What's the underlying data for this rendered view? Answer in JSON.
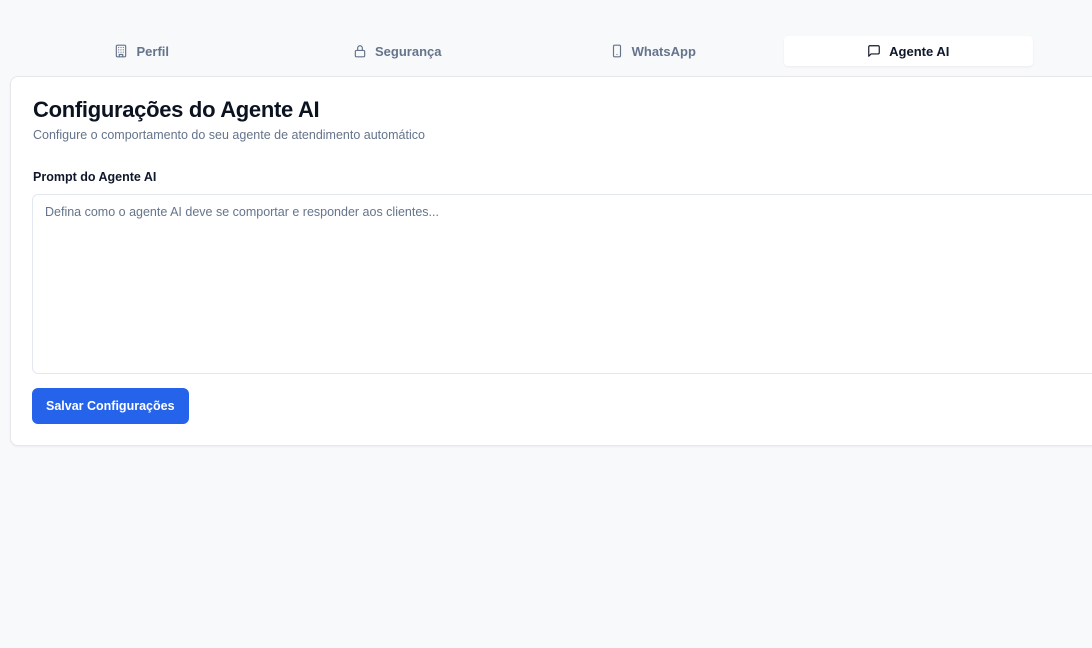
{
  "tabs": [
    {
      "label": "Perfil",
      "icon": "building-icon",
      "active": false
    },
    {
      "label": "Segurança",
      "icon": "lock-icon",
      "active": false
    },
    {
      "label": "WhatsApp",
      "icon": "smartphone-icon",
      "active": false
    },
    {
      "label": "Agente AI",
      "icon": "message-square-icon",
      "active": true
    }
  ],
  "card": {
    "title": "Configurações do Agente AI",
    "description": "Configure o comportamento do seu agente de atendimento automático",
    "prompt_label": "Prompt do Agente AI",
    "prompt_value": "",
    "prompt_placeholder": "Defina como o agente AI deve se comportar e responder aos clientes...",
    "save_label": "Salvar Configurações"
  },
  "colors": {
    "background": "#f8f9fb",
    "primary": "#2563eb",
    "muted_text": "#64748b",
    "card_border": "#e5e7eb"
  }
}
